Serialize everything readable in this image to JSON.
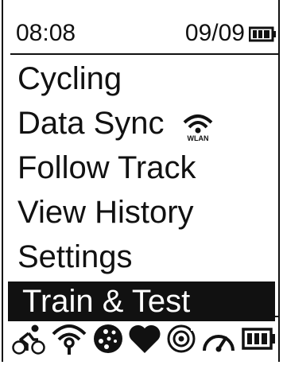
{
  "status": {
    "time": "08:08",
    "date": "09/09",
    "battery_icon": "battery-full-icon"
  },
  "menu": {
    "items": [
      {
        "label": "Cycling"
      },
      {
        "label": "Data Sync",
        "icon": "wlan-icon",
        "icon_label": "WLAN"
      },
      {
        "label": "Follow Track"
      },
      {
        "label": "View History"
      },
      {
        "label": "Settings"
      },
      {
        "label": "Train & Test",
        "selected": true
      }
    ]
  },
  "bottom_icons": [
    "cycling-icon",
    "wifi-signal-icon",
    "satellite-icon",
    "heart-rate-icon",
    "cadence-sensor-icon",
    "speed-sensor-icon",
    "battery-icon"
  ],
  "colors": {
    "foreground": "#111111",
    "background": "#ffffff"
  }
}
